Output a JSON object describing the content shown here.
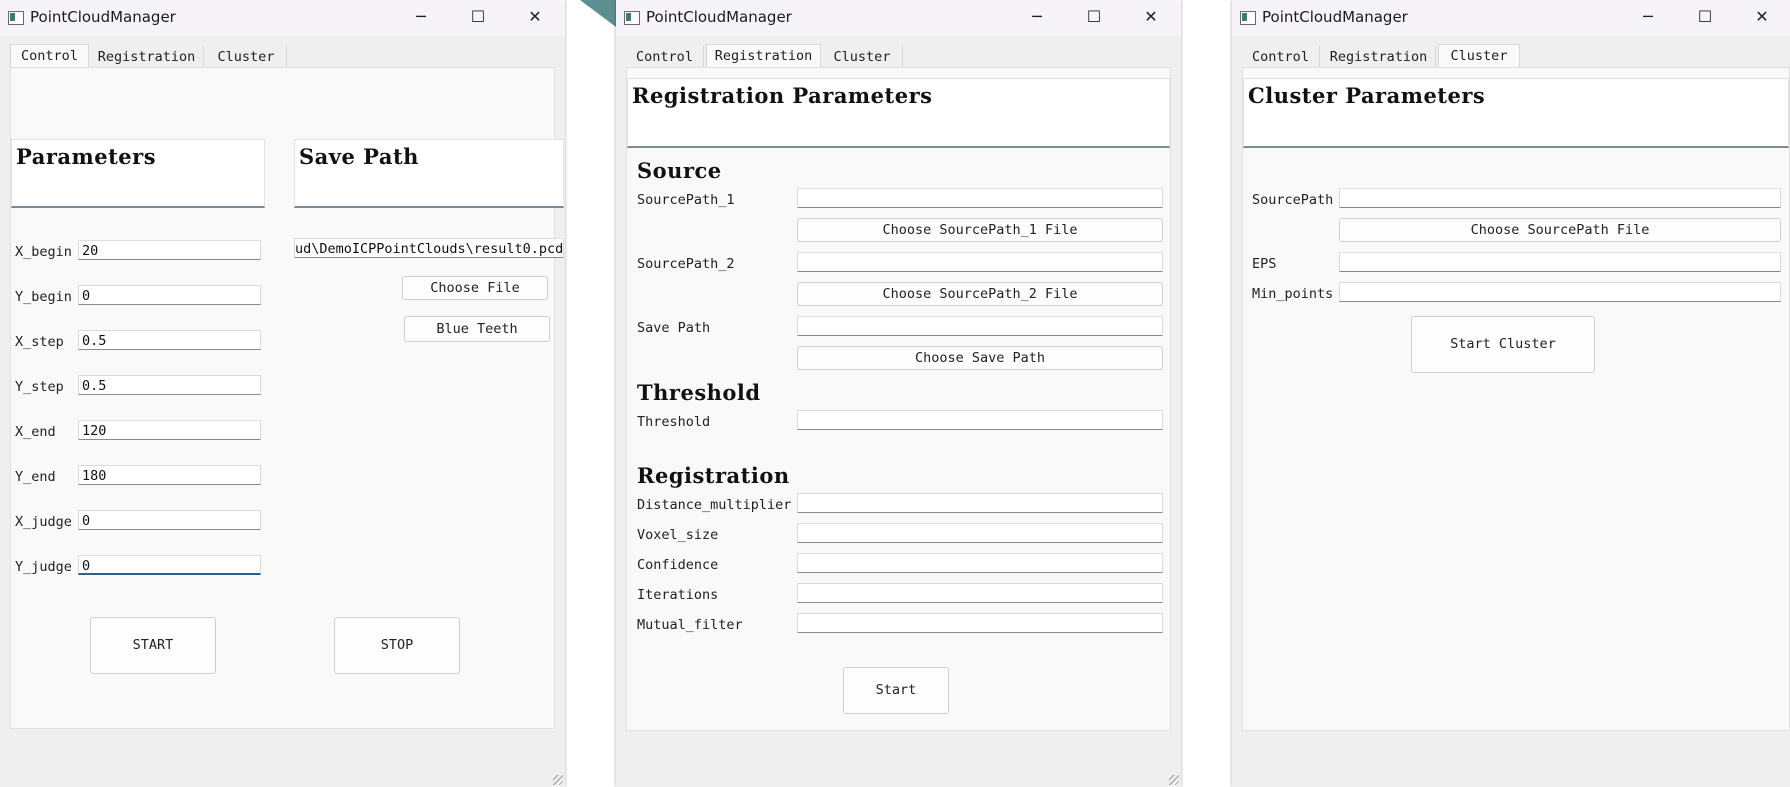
{
  "app_title": "PointCloudManager",
  "window_controls": {
    "minimize": "─",
    "maximize": "☐",
    "close": "✕"
  },
  "tabs": [
    "Control",
    "Registration",
    "Cluster"
  ],
  "control": {
    "parameters_header": "Parameters",
    "save_path_header": "Save Path",
    "params": [
      {
        "label": "X_begin",
        "value": "20"
      },
      {
        "label": "Y_begin",
        "value": "0"
      },
      {
        "label": "X_step",
        "value": "0.5"
      },
      {
        "label": "Y_step",
        "value": "0.5"
      },
      {
        "label": "X_end",
        "value": "120"
      },
      {
        "label": "Y_end",
        "value": "180"
      },
      {
        "label": "X_judge",
        "value": "0"
      },
      {
        "label": "Y_judge",
        "value": "0"
      }
    ],
    "save_path_value": "ud\\DemoICPPointClouds\\result0.pcd",
    "choose_file": "Choose File",
    "blue_teeth": "Blue Teeth",
    "start": "START",
    "stop": "STOP"
  },
  "registration": {
    "header": "Registration Parameters",
    "source_section": "Source",
    "source_path_1": "SourcePath_1",
    "choose_source_1": "Choose SourcePath_1 File",
    "source_path_2": "SourcePath_2",
    "choose_source_2": "Choose SourcePath_2 File",
    "save_path": "Save Path",
    "choose_save_path": "Choose Save Path",
    "threshold_section": "Threshold",
    "threshold": "Threshold",
    "registration_section": "Registration",
    "distance_multiplier": "Distance_multiplier",
    "voxel_size": "Voxel_size",
    "confidence": "Confidence",
    "iterations": "Iterations",
    "mutual_filter": "Mutual_filter",
    "start": "Start"
  },
  "cluster": {
    "header": "Cluster Parameters",
    "source_path": "SourcePath",
    "choose_source": "Choose SourcePath File",
    "eps": "EPS",
    "min_points": "Min_points",
    "start_cluster": "Start Cluster"
  }
}
